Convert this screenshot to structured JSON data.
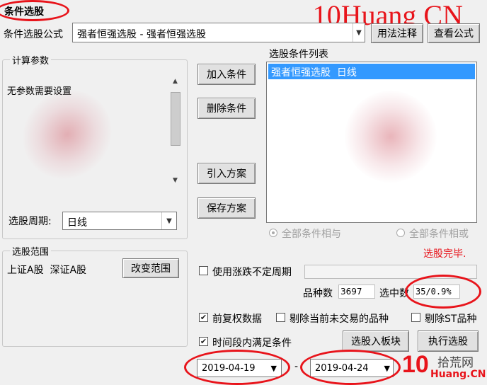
{
  "window": {
    "title": "条件选股"
  },
  "watermark": {
    "text": "10Huang CN"
  },
  "formula": {
    "label": "条件选股公式",
    "value": "强者恒强选股 - 强者恒强选股",
    "annotate_button": "用法注释",
    "view_button": "查看公式"
  },
  "params": {
    "group_label": "计算参数",
    "text": "无参数需要设置",
    "period_label": "选股周期:",
    "period_value": "日线"
  },
  "actions": {
    "add": "加入条件",
    "delete": "删除条件",
    "import": "引入方案",
    "save": "保存方案"
  },
  "conditions": {
    "label": "选股条件列表",
    "items": [
      "强者恒强选股  日线"
    ]
  },
  "logic": {
    "all_and": "全部条件相与",
    "all_or": "全部条件相或"
  },
  "status": {
    "text": "选股完毕."
  },
  "range": {
    "group_label": "选股范围",
    "value": "上证A股  深证A股",
    "change_button": "改变范围"
  },
  "options": {
    "uncertain_period": "使用涨跌不定周期",
    "count_label": "品种数",
    "count_value": "3697",
    "selected_label": "选中数",
    "selected_value": "35/0.9%",
    "pre_adjust": "前复权数据",
    "exclude_untraded": "剔除当前未交易的品种",
    "exclude_st": "剔除ST品种",
    "time_range": "时间段内满足条件"
  },
  "dates": {
    "start": "2019-04-19",
    "end": "2019-04-24",
    "separator": "-"
  },
  "buttons": {
    "to_block": "选股入板块",
    "execute": "执行选股"
  },
  "logo": {
    "digits": "10",
    "cn": "拾荒网",
    "en": "Huang.CN"
  },
  "colors": {
    "accent": "#e8141b",
    "selection": "#3399ff"
  }
}
